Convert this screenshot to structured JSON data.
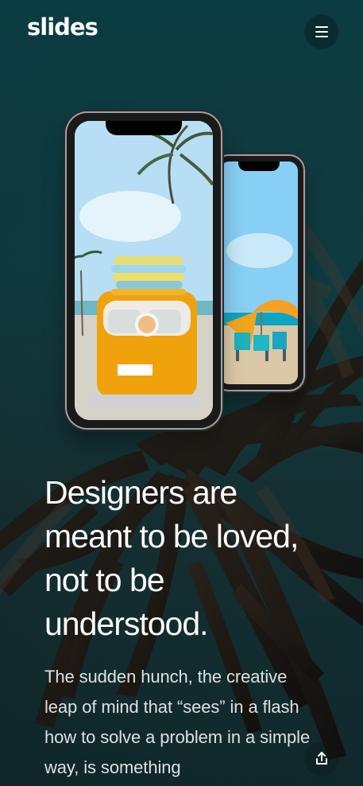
{
  "header": {
    "logo_text": "slides",
    "menu_icon": "hamburger-icon"
  },
  "hero": {
    "headline": "Designers are meant to be loved, not to be understood.",
    "body": "The sudden hunch, the creative leap of mind that “sees” in a flash how to solve a problem in a simple way, is something"
  },
  "actions": {
    "share_icon": "share-icon"
  },
  "colors": {
    "background": "#0c3d43",
    "menu_button": "#0a2b30",
    "text": "#ffffff"
  }
}
